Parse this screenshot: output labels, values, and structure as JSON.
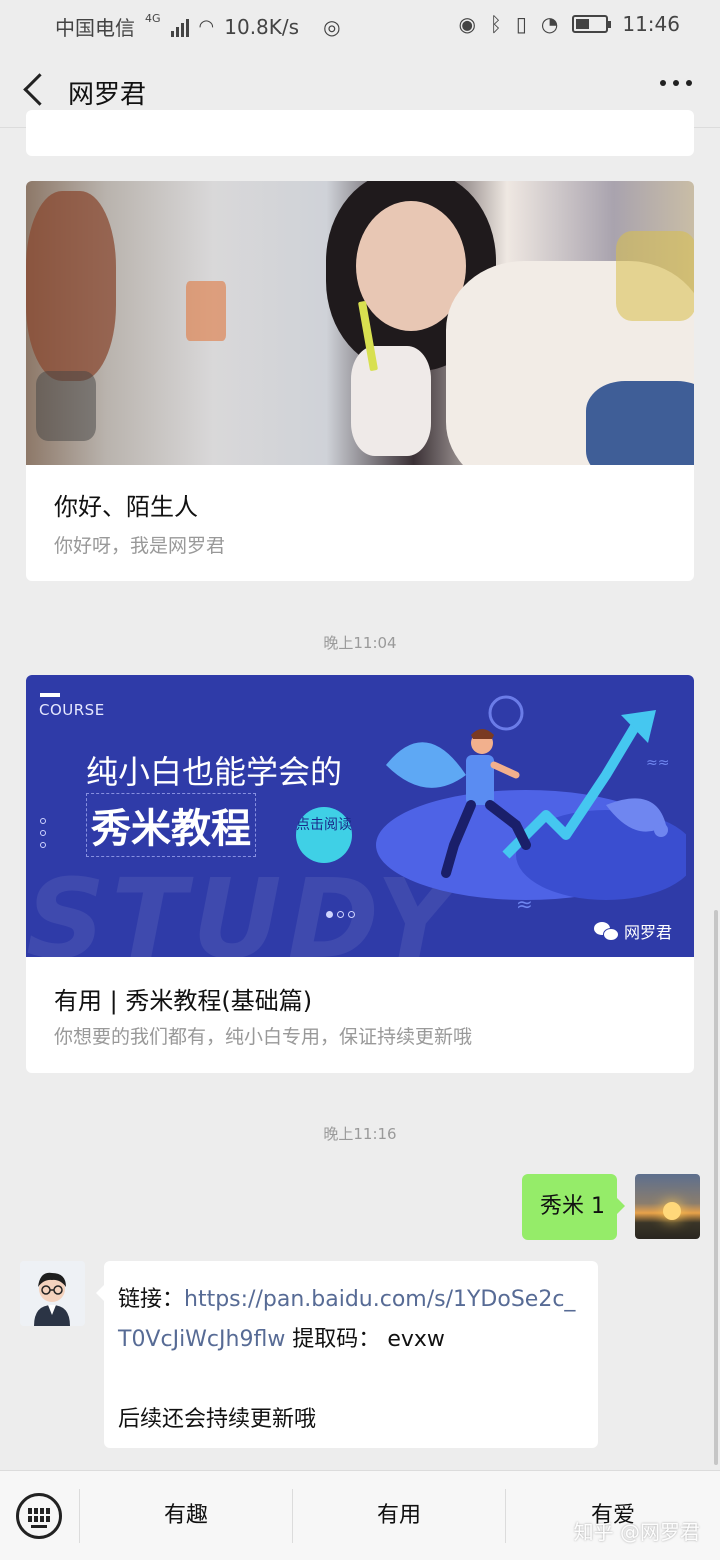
{
  "status_bar": {
    "carrier": "中国电信",
    "network": "4G",
    "speed": "10.8K/s",
    "time": "11:46",
    "battery_level": 0.45
  },
  "nav": {
    "title": "网罗君",
    "back_icon": "chevron-left-icon",
    "more_icon": "more-dots-icon"
  },
  "articles": [
    {
      "title": "你好、陌生人",
      "subtitle": "你好呀，我是网罗君"
    },
    {
      "title": "有用 | 秀米教程(基础篇)",
      "subtitle": "你想要的我们都有，纯小白专用，保证持续更新哦",
      "banner": {
        "course": "COURSE",
        "headline1": "纯小白也能学会的",
        "headline2": "秀米教程",
        "read_badge": "点击阅读",
        "bg_word": "STUDY",
        "brand": "网罗君"
      }
    }
  ],
  "timestamps": [
    "晚上11:04",
    "晚上11:16"
  ],
  "messages": {
    "outgoing": "秀米 1",
    "incoming": {
      "link_label": "链接：",
      "link_part1": "https://pan.baidu.com/s/1YDoSe2c_",
      "link_part2": "T0VcJiWcJh9flw",
      "code_label": " 提取码：",
      "code": "evxw",
      "footer": "后续还会持续更新哦"
    }
  },
  "bottom_menu": {
    "items": [
      "有趣",
      "有用",
      "有爱"
    ],
    "watermark": "知乎 @网罗君"
  },
  "colors": {
    "outgoing_bubble": "#95ec69",
    "link": "#576b95",
    "banner_bg": "#2f3ba8"
  }
}
